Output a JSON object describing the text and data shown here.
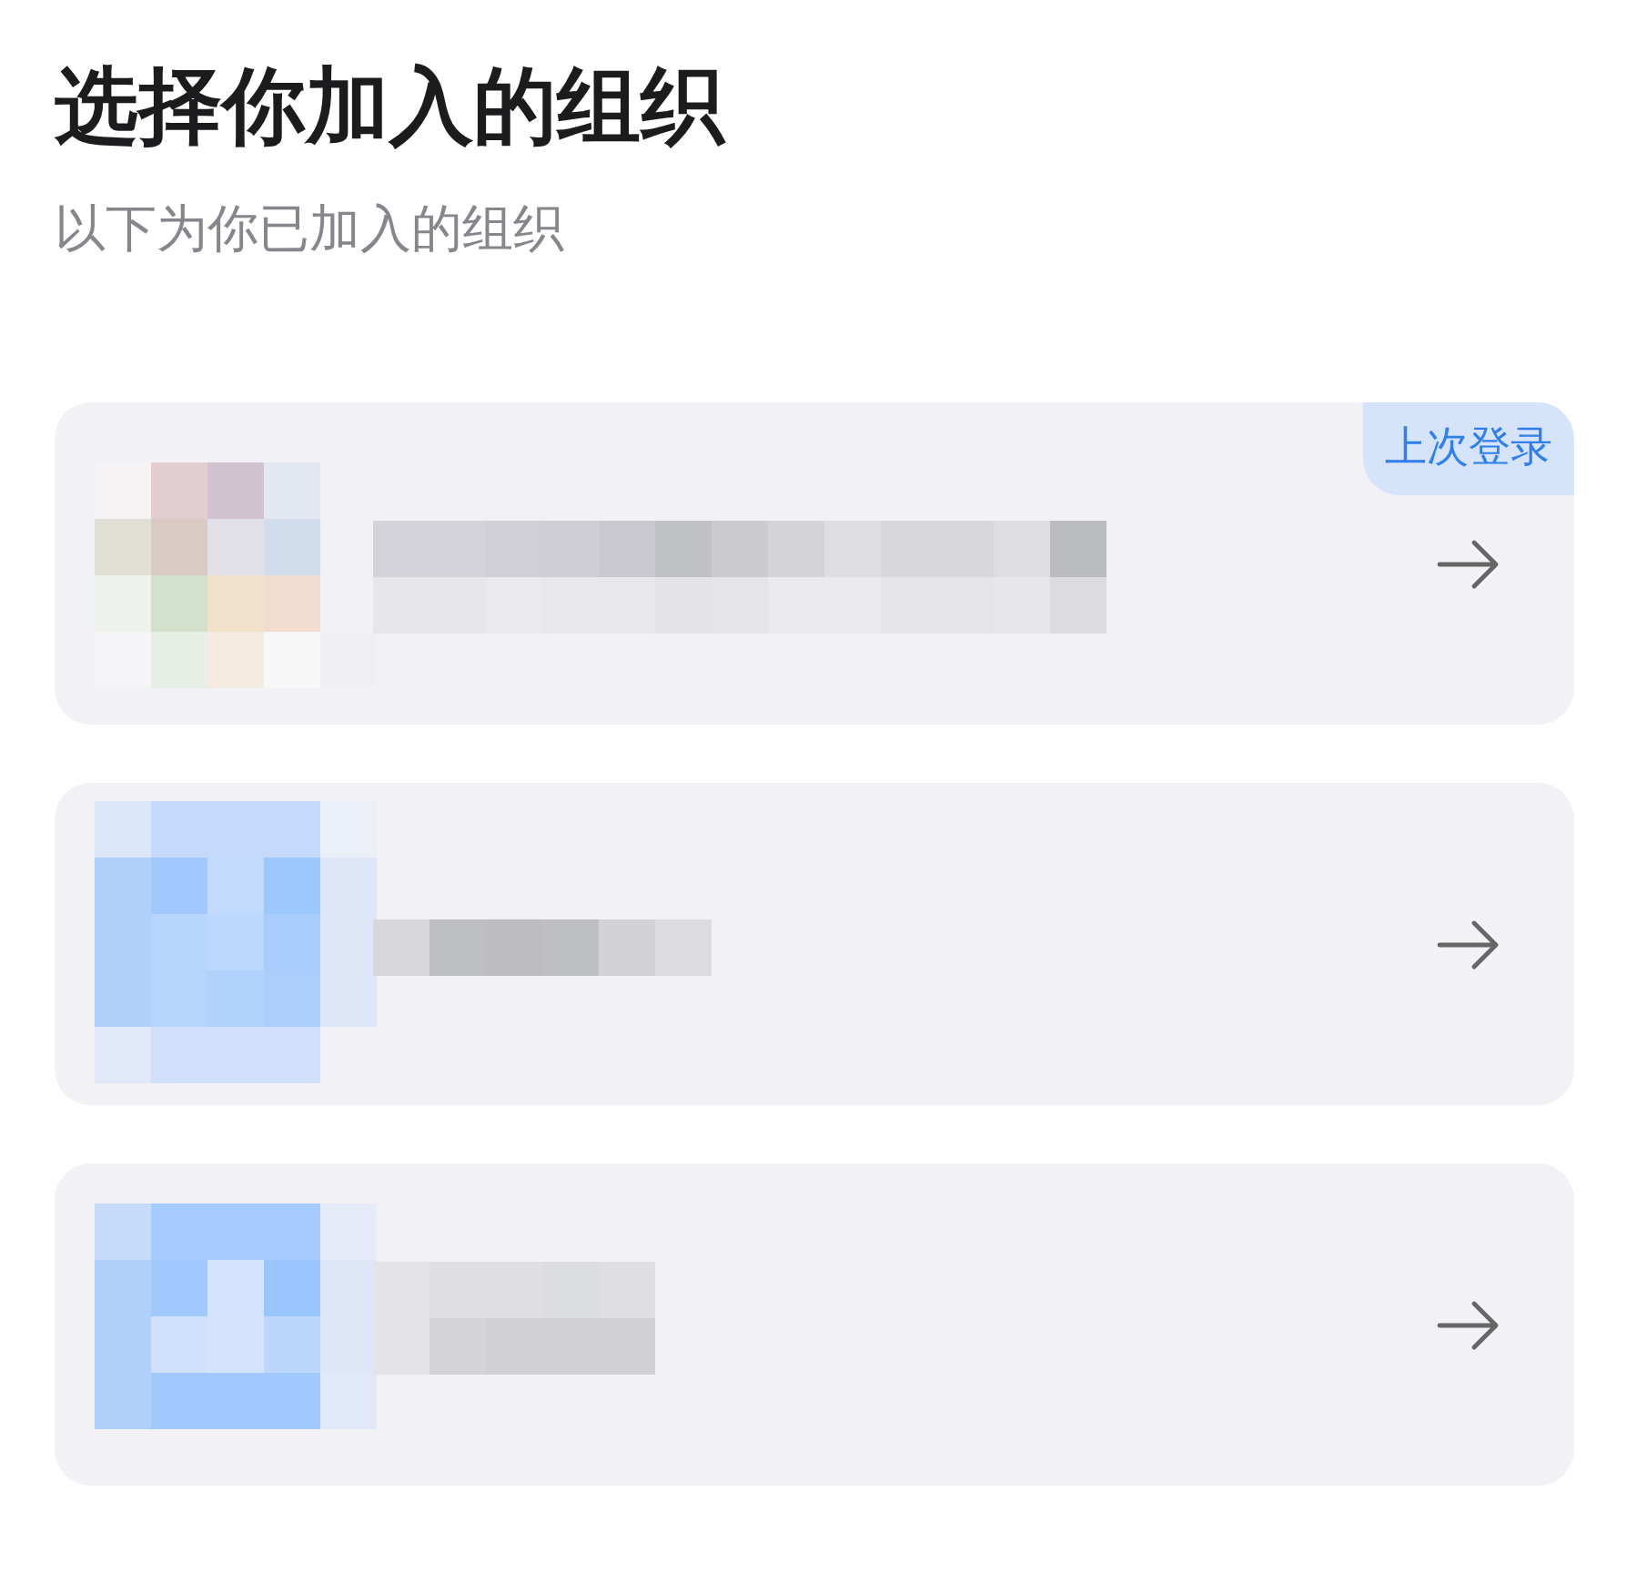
{
  "title": "选择你加入的组织",
  "subtitle": "以下为你已加入的组织",
  "organizations": [
    {
      "kind": "picture",
      "badge": "上次登录"
    },
    {
      "kind": "picture"
    },
    {
      "kind": "picture"
    }
  ]
}
